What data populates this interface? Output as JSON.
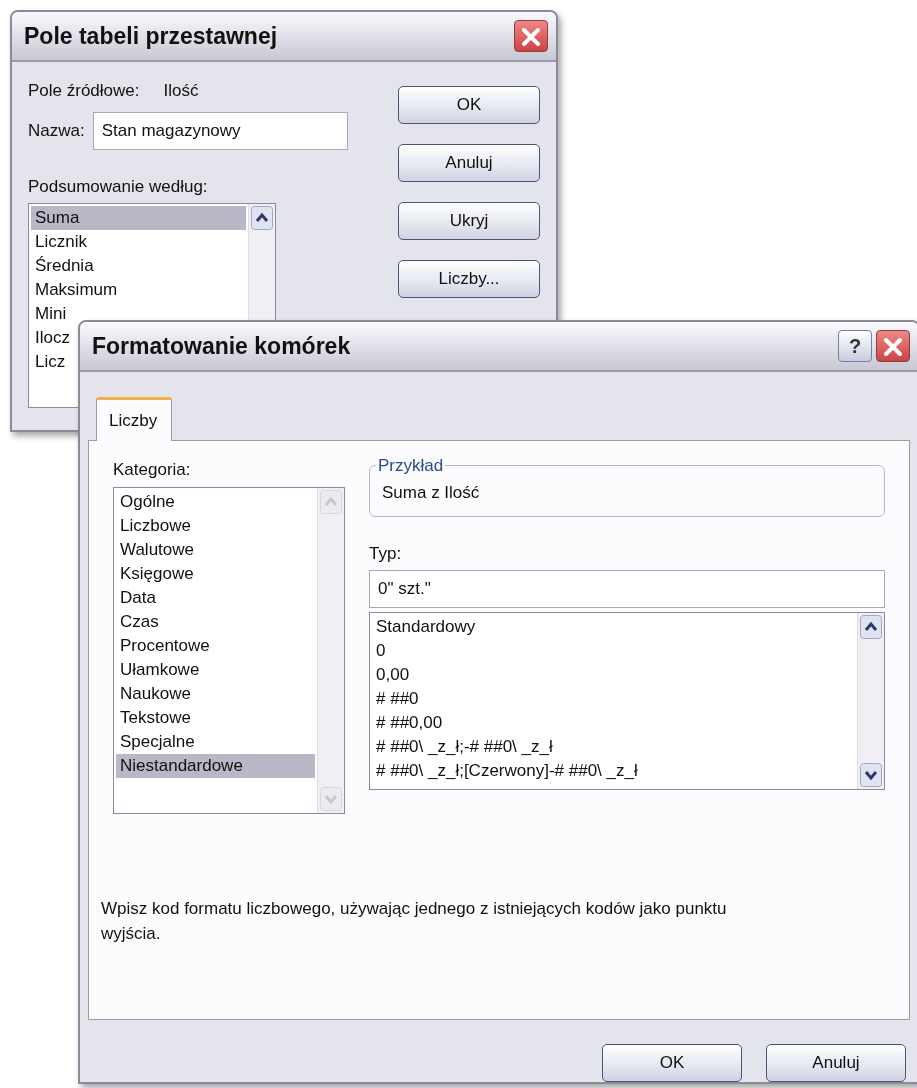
{
  "pivot_dialog": {
    "title": "Pole tabeli przestawnej",
    "source_label": "Pole źródłowe:",
    "source_value": "Ilość",
    "name_label": "Nazwa:",
    "name_value": "Stan magazynowy",
    "summary_label": "Podsumowanie według:",
    "summary_items": [
      {
        "label": "Suma",
        "selected": true
      },
      {
        "label": "Licznik",
        "selected": false
      },
      {
        "label": "Średnia",
        "selected": false
      },
      {
        "label": "Maksimum",
        "selected": false
      },
      {
        "label": "Mini",
        "selected": false
      },
      {
        "label": "Ilocz",
        "selected": false
      },
      {
        "label": "Licz",
        "selected": false
      }
    ],
    "buttons": [
      "OK",
      "Anuluj",
      "Ukryj",
      "Liczby..."
    ]
  },
  "format_dialog": {
    "title": "Formatowanie komórek",
    "help_button": "?",
    "tabs": [
      {
        "label": "Liczby",
        "selected": true
      }
    ],
    "category_label": "Kategoria:",
    "categories": [
      {
        "label": "Ogólne",
        "selected": false
      },
      {
        "label": "Liczbowe",
        "selected": false
      },
      {
        "label": "Walutowe",
        "selected": false
      },
      {
        "label": "Księgowe",
        "selected": false
      },
      {
        "label": "Data",
        "selected": false
      },
      {
        "label": "Czas",
        "selected": false
      },
      {
        "label": "Procentowe",
        "selected": false
      },
      {
        "label": "Ułamkowe",
        "selected": false
      },
      {
        "label": "Naukowe",
        "selected": false
      },
      {
        "label": "Tekstowe",
        "selected": false
      },
      {
        "label": "Specjalne",
        "selected": false
      },
      {
        "label": "Niestandardowe",
        "selected": true
      }
    ],
    "sample_label": "Przykład",
    "sample_value": "Suma z Ilość",
    "type_label": "Typ:",
    "type_value": "0\" szt.\"",
    "type_items": [
      "Standardowy",
      "0",
      "0,00",
      "# ##0",
      "# ##0,00",
      "# ##0\\ _z_ł;-# ##0\\ _z_ł",
      "# ##0\\ _z_ł;[Czerwony]-# ##0\\ _z_ł"
    ],
    "description": "Wpisz kod formatu liczbowego, używając jednego z istniejących kodów jako punktu wyjścia.",
    "buttons": [
      "OK",
      "Anuluj"
    ]
  }
}
